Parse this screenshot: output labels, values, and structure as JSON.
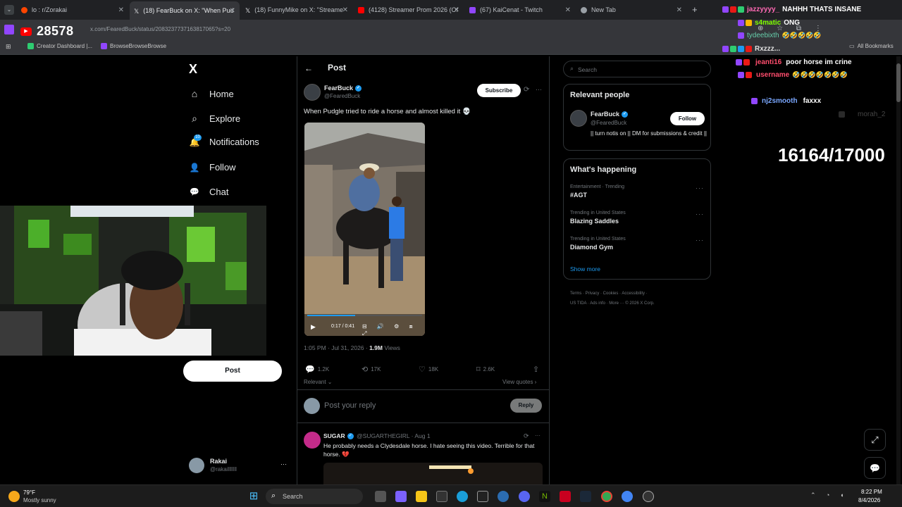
{
  "browser": {
    "tabs": [
      {
        "label": "lo : r/Zorakai",
        "color": "#ff4500",
        "active": false
      },
      {
        "label": "(18) FearBuck on X: \"When Pud",
        "color": "#e7e9ea",
        "active": true
      },
      {
        "label": "(18) FunnyMike on X: \"Streame",
        "color": "#e7e9ea",
        "active": false
      },
      {
        "label": "(4128) Streamer Prom 2026 (Of",
        "color": "#ff0000",
        "active": false
      },
      {
        "label": "(67) KaiCenat - Twitch",
        "color": "#9146ff",
        "active": false
      },
      {
        "label": "New Tab",
        "color": "#9aa0a6",
        "active": false
      }
    ],
    "new_tab": "+",
    "url": "x.com/FearedBuck/status/2083237737163817065?s=20",
    "bookmarks": [
      "Creator Dashboard |...",
      "BrowseBrowseBrowse"
    ],
    "all_bookmarks": "All Bookmarks"
  },
  "stream": {
    "viewers": "28578",
    "subgoal": "16164/17000"
  },
  "xnav": {
    "logo": "X",
    "items": [
      {
        "label": "Home",
        "icon": "⌂"
      },
      {
        "label": "Explore",
        "icon": "⌕"
      },
      {
        "label": "Notifications",
        "icon": "🔔",
        "badge": "10"
      },
      {
        "label": "Follow",
        "icon": "👤"
      },
      {
        "label": "Chat",
        "icon": "💬"
      }
    ],
    "post_button": "Post",
    "account_name": "Rakai",
    "account_handle": "@rakailllllll"
  },
  "post": {
    "header": "Post",
    "author_name": "FearBuck",
    "author_handle": "@FearedBuck",
    "subscribe": "Subscribe",
    "text": "When Pudgle tried to ride a horse and almost killed it 💀",
    "video_time": "0:17 / 0:41",
    "timestamp": "1:05 PM · Jul 31, 2026 · ",
    "views_count": "1.9M",
    "views_label": " Views",
    "replies": "1.2K",
    "reposts": "17K",
    "likes": "18K",
    "bookmarks": "2.6K",
    "relevant": "Relevant",
    "view_quotes": "View quotes",
    "reply_placeholder": "Post your reply",
    "reply_button": "Reply"
  },
  "reply": {
    "name": "SUGAR",
    "handle": "@SUGARTHEGIRL · Aug 1",
    "text": "He probably needs a Clydesdale horse. I hate seeing this video. Terrible for that horse. 💔"
  },
  "sidebar": {
    "search_placeholder": "Search",
    "relevant_title": "Relevant people",
    "rp_name": "FearBuck",
    "rp_handle": "@FearedBuck",
    "rp_bio": "|| turn notis on || DM for submissions & credit ||",
    "follow": "Follow",
    "happening_title": "What's happening",
    "trends": [
      {
        "category": "Entertainment · Trending",
        "name": "#AGT"
      },
      {
        "category": "Trending in United States",
        "name": "Blazing Saddles"
      },
      {
        "category": "Trending in United States",
        "name": "Diamond Gym"
      }
    ],
    "show_more": "Show more",
    "footer1": "Terms · Privacy · Cookies · Accessibility ·",
    "footer2": "US TIDA · Ads info · More ··· © 2026 X Corp."
  },
  "chat": [
    {
      "user": "jazzyyyy_",
      "msg": "NAHHH THATS INSANE",
      "color": "#ff69b4"
    },
    {
      "user": "s4matic",
      "msg": "ONG",
      "color": "#7fff00"
    },
    {
      "user": "tydeebixth",
      "msg": "",
      "color": "#66cdaa"
    },
    {
      "user": "Rxzzz...",
      "msg": "",
      "color": "#e0e0e0"
    },
    {
      "user": "jeanti16",
      "msg": "poor horse im crine",
      "color": "#ff4d6d"
    },
    {
      "user": "username",
      "msg": "🤣🤣🤣🤣🤣🤣🤣",
      "color": "#ff4d6d"
    },
    {
      "user": "nj2smooth",
      "msg": "faxxx",
      "color": "#7aa7ff"
    },
    {
      "user": "morah_2",
      "msg": "",
      "color": "#555"
    }
  ],
  "taskbar": {
    "weather_temp": "79°F",
    "weather_desc": "Mostly sunny",
    "search": "Search",
    "time": "8:22 PM",
    "date": "8/4/2026"
  }
}
